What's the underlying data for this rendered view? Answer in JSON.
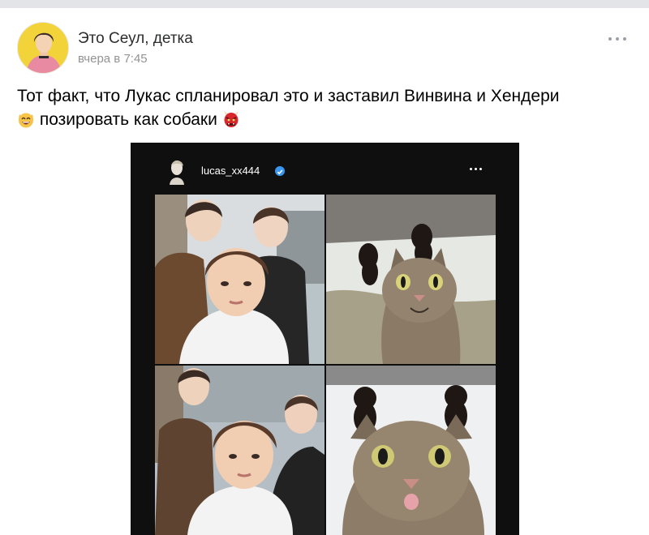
{
  "post": {
    "author": "Это Сеул, детка",
    "time": "вчера в 7:45",
    "text_part1": "Тот факт, что Лукас спланировал это и заставил Винвина и Хендери",
    "text_part2": "позировать как собаки"
  },
  "embedded_screenshot": {
    "username": "lucas_xx444"
  },
  "icons": {
    "more": "more-horizontal-icon",
    "verified": "verified-badge-icon",
    "emoji1": "grinning-cat-emoji",
    "emoji2": "ogre-emoji"
  },
  "colors": {
    "author": "#2c2d2e",
    "time": "#939393",
    "verified": "#3897f0",
    "photo_background": "#0f0f10"
  }
}
